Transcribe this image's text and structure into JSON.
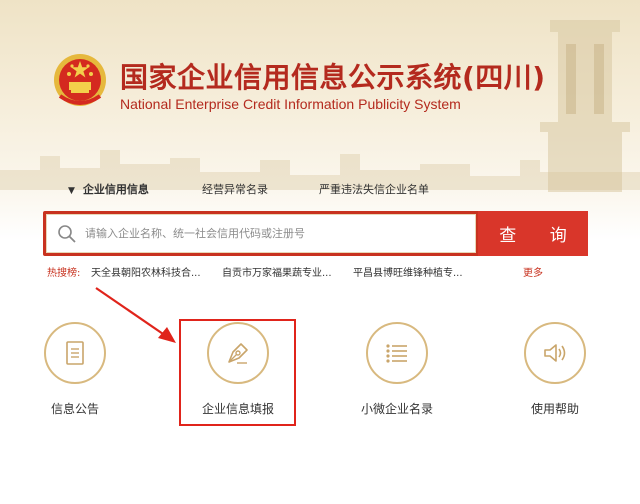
{
  "header": {
    "title_cn": "国家企业信用信息公示系统(四川)",
    "title_en": "National Enterprise Credit Information Publicity System",
    "emblem_icon": "national-emblem-icon"
  },
  "nav": {
    "tabs": [
      {
        "label": "企业信用信息",
        "active": true
      },
      {
        "label": "经营异常名录",
        "active": false
      },
      {
        "label": "严重违法失信企业名单",
        "active": false
      }
    ]
  },
  "search": {
    "placeholder": "请输入企业名称、统一社会信用代码或注册号",
    "button_label": "查 询",
    "icon": "search-icon"
  },
  "hot_search": {
    "label": "热搜榜:",
    "items": [
      "天全县朝阳农林科技合...",
      "自贡市万家福果蔬专业...",
      "平昌县博旺维锋种植专..."
    ],
    "more_label": "更多"
  },
  "features": [
    {
      "label": "信息公告",
      "icon": "document-icon"
    },
    {
      "label": "企业信息填报",
      "icon": "pen-nib-icon"
    },
    {
      "label": "小微企业名录",
      "icon": "list-icon"
    },
    {
      "label": "使用帮助",
      "icon": "speaker-icon"
    }
  ],
  "colors": {
    "brand_red": "#c8321f",
    "button_red": "#d9362a",
    "gold": "#d8b97f",
    "highlight_red": "#e0241b"
  }
}
